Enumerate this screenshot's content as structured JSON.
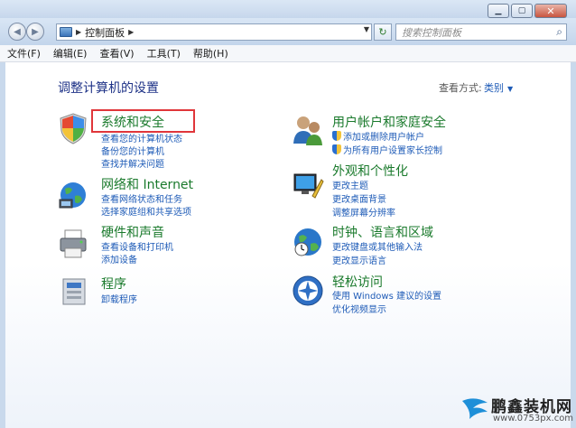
{
  "window": {
    "address_crumb": "控制面板",
    "search_placeholder": "搜索控制面板",
    "menu": [
      "文件(F)",
      "编辑(E)",
      "查看(V)",
      "工具(T)",
      "帮助(H)"
    ]
  },
  "main": {
    "title": "调整计算机的设置",
    "view_by_label": "查看方式:",
    "view_by_value": "类别"
  },
  "categories_left": [
    {
      "title": "系统和安全",
      "links": [
        "查看您的计算机状态",
        "备份您的计算机",
        "查找并解决问题"
      ],
      "icon": "security-shield-icon"
    },
    {
      "title": "网络和 Internet",
      "links": [
        "查看网络状态和任务",
        "选择家庭组和共享选项"
      ],
      "icon": "network-globe-icon"
    },
    {
      "title": "硬件和声音",
      "links": [
        "查看设备和打印机",
        "添加设备"
      ],
      "icon": "printer-icon"
    },
    {
      "title": "程序",
      "links": [
        "卸载程序"
      ],
      "icon": "programs-icon"
    }
  ],
  "categories_right": [
    {
      "title": "用户帐户和家庭安全",
      "links": [
        "添加或删除用户帐户",
        "为所有用户设置家长控制"
      ],
      "icon": "users-icon"
    },
    {
      "title": "外观和个性化",
      "links": [
        "更改主题",
        "更改桌面背景",
        "调整屏幕分辨率"
      ],
      "icon": "appearance-icon"
    },
    {
      "title": "时钟、语言和区域",
      "links": [
        "更改键盘或其他输入法",
        "更改显示语言"
      ],
      "icon": "clock-globe-icon"
    },
    {
      "title": "轻松访问",
      "links": [
        "使用 Windows 建议的设置",
        "优化视频显示"
      ],
      "icon": "ease-of-access-icon"
    }
  ],
  "watermark": {
    "title": "鹏鑫装机网",
    "url": "www.0753px.com"
  }
}
